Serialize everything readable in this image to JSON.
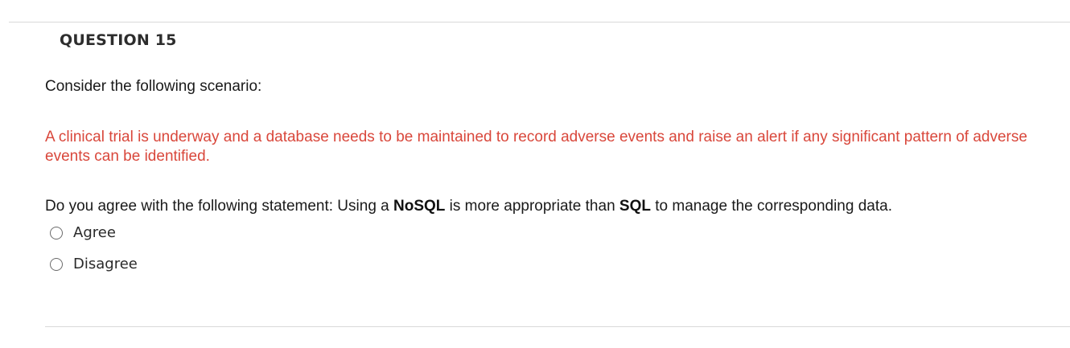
{
  "question": {
    "title": "QUESTION 15",
    "intro": "Consider the following scenario:",
    "scenario": "A clinical trial is underway and a database needs to be maintained to record adverse events and raise an alert if any significant pattern of adverse events can be identified.",
    "statement": {
      "part1": "Do you agree with the following statement: Using a ",
      "bold1": "NoSQL",
      "part2": " is more appropriate than ",
      "bold2": "SQL",
      "part3": " to manage the corresponding data."
    },
    "options": [
      {
        "label": "Agree",
        "selected": false
      },
      {
        "label": "Disagree",
        "selected": false
      }
    ]
  },
  "colors": {
    "scenario_text": "#d9473b",
    "divider": "#d9d9d9"
  }
}
